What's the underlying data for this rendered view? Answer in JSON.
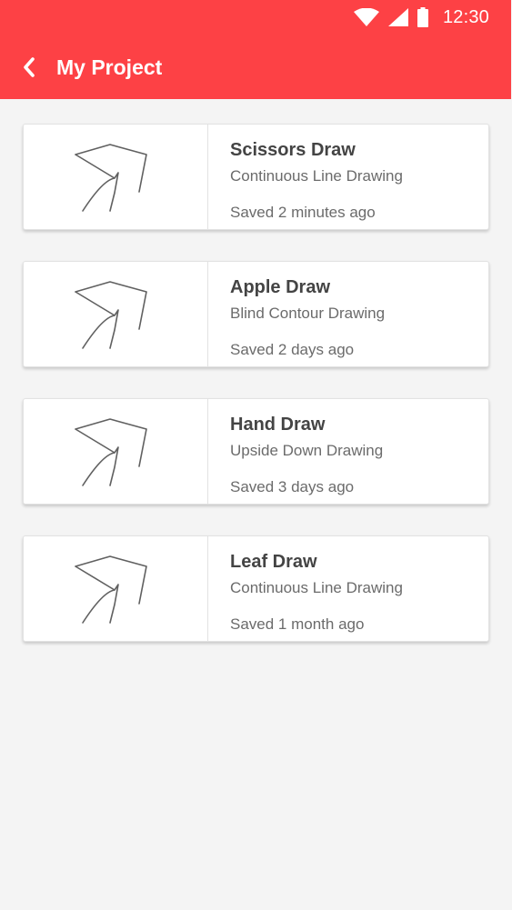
{
  "colors": {
    "accent": "#fd4145",
    "background": "#f4f4f4",
    "card": "#ffffff"
  },
  "status_bar": {
    "icons": [
      "wifi-icon",
      "cellular-signal-icon",
      "battery-icon"
    ],
    "time": "12:30"
  },
  "toolbar": {
    "back_icon": "chevron-left-icon",
    "title": "My Project"
  },
  "projects": [
    {
      "title": "Scissors Draw",
      "type": "Continuous Line Drawing",
      "saved": "Saved 2 minutes ago",
      "thumbnail": "sketch-thumbnail"
    },
    {
      "title": "Apple Draw",
      "type": "Blind Contour Drawing",
      "saved": "Saved 2 days ago",
      "thumbnail": "sketch-thumbnail"
    },
    {
      "title": "Hand Draw",
      "type": "Upside Down Drawing",
      "saved": "Saved 3 days ago",
      "thumbnail": "sketch-thumbnail"
    },
    {
      "title": "Leaf Draw",
      "type": "Continuous Line Drawing",
      "saved": "Saved 1 month ago",
      "thumbnail": "sketch-thumbnail"
    }
  ]
}
